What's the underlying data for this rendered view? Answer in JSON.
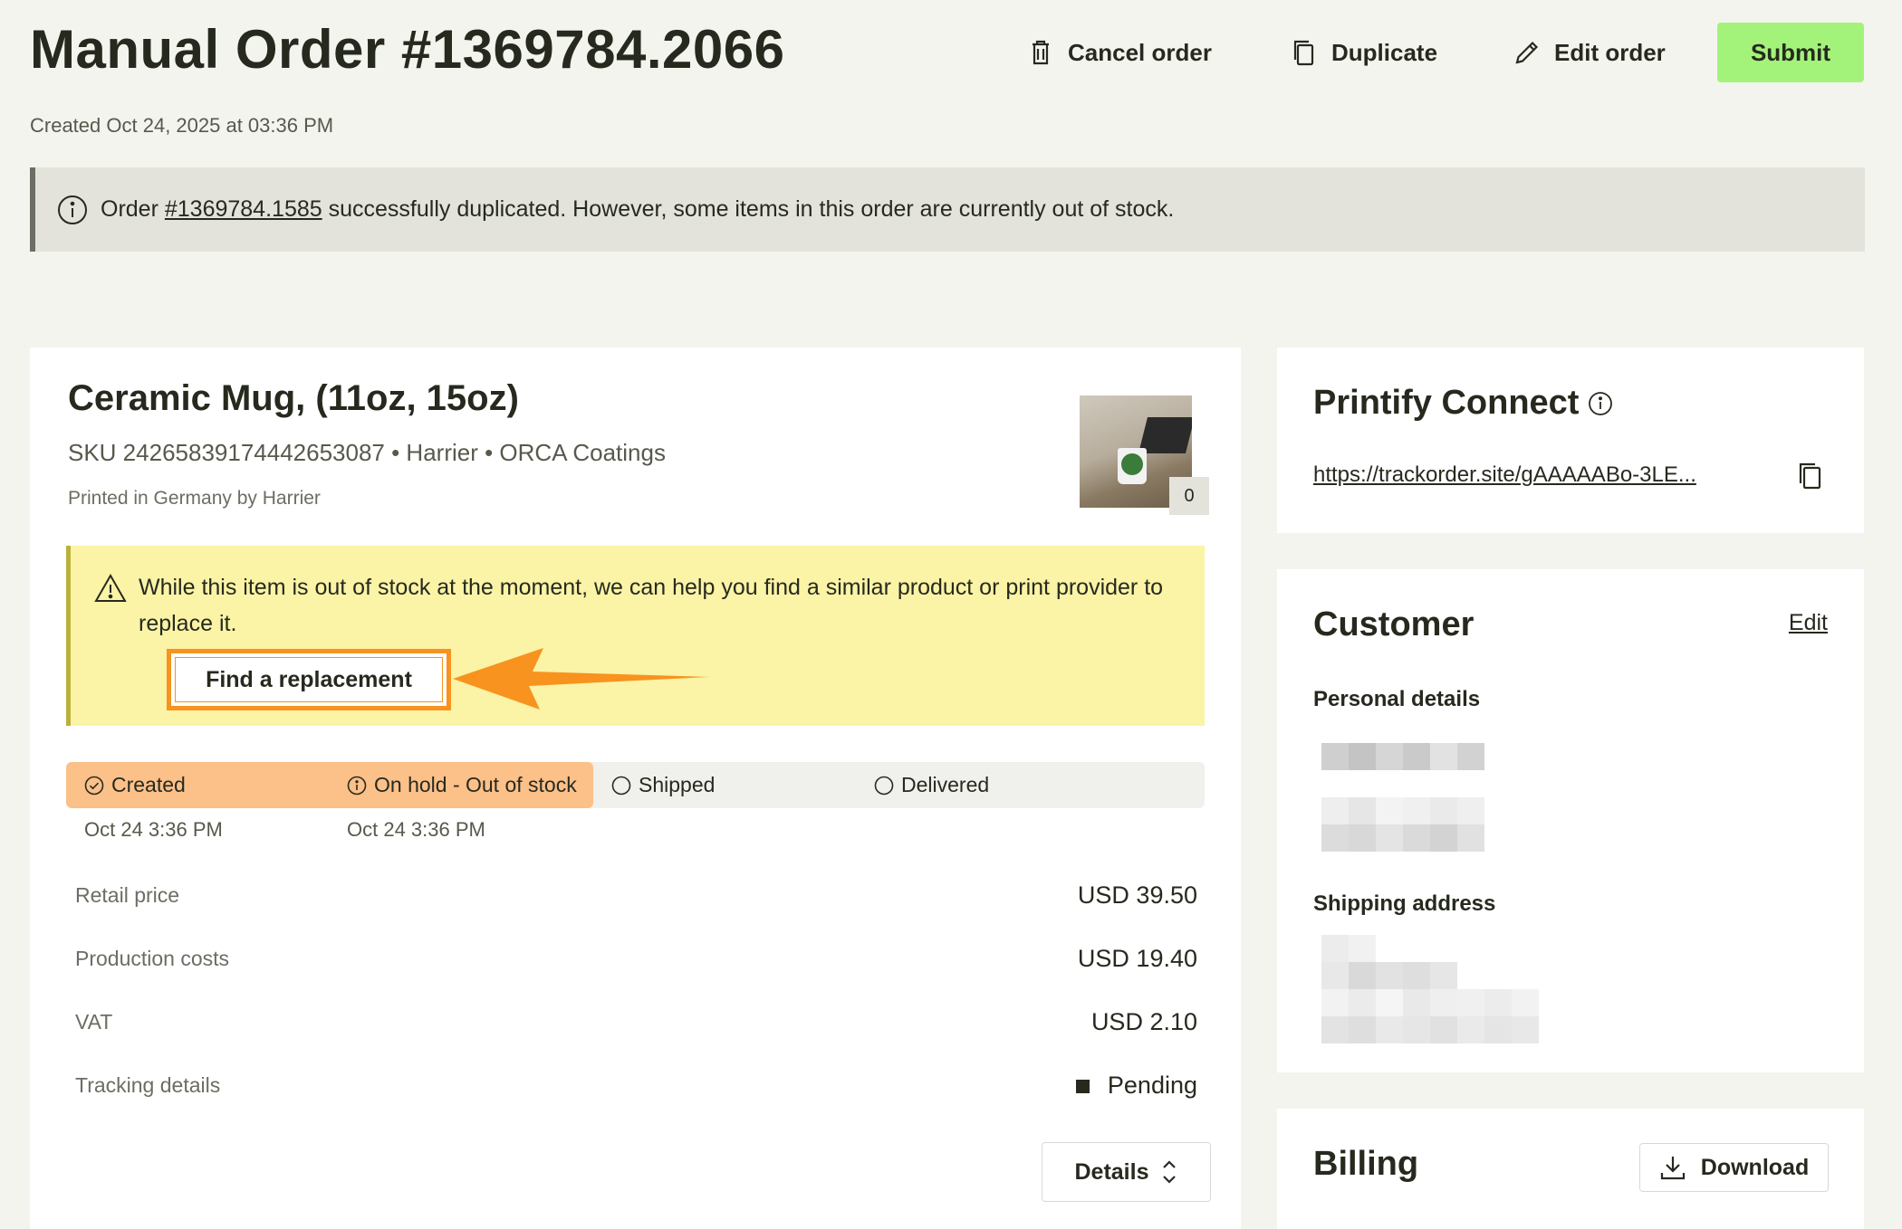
{
  "header": {
    "title": "Manual Order #1369784.2066",
    "created": "Created Oct 24, 2025 at 03:36 PM",
    "actions": {
      "cancel": "Cancel order",
      "duplicate": "Duplicate",
      "edit": "Edit order",
      "submit": "Submit"
    }
  },
  "banner": {
    "prefix": "Order",
    "link": "#1369784.1585",
    "suffix": " successfully duplicated. However, some items in this order are currently out of stock."
  },
  "product": {
    "title": "Ceramic Mug, (11oz, 15oz)",
    "sku_line": "SKU 24265839174442653087 • Harrier • ORCA Coatings",
    "printed": "Printed in Germany by Harrier",
    "thumb_count": "0",
    "warning": "While this item is out of stock at the moment, we can help you find a similar product or print provider to replace it.",
    "replace_button": "Find a replacement",
    "status": {
      "steps": [
        {
          "label": "Created",
          "date": "Oct 24 3:36 PM"
        },
        {
          "label": "On hold - Out of stock",
          "date": "Oct 24 3:36 PM"
        },
        {
          "label": "Shipped",
          "date": ""
        },
        {
          "label": "Delivered",
          "date": ""
        }
      ],
      "progress_steps_completed": 2
    },
    "rows": [
      {
        "label": "Retail price",
        "value": "USD 39.50"
      },
      {
        "label": "Production costs",
        "value": "USD 19.40"
      },
      {
        "label": "VAT",
        "value": "USD 2.10"
      },
      {
        "label": "Tracking details",
        "value": "Pending"
      }
    ],
    "details_button": "Details"
  },
  "connect": {
    "title": "Printify Connect",
    "url": "https://trackorder.site/gAAAAABo-3LE..."
  },
  "customer": {
    "title": "Customer",
    "edit": "Edit",
    "personal_label": "Personal details",
    "shipping_label": "Shipping address"
  },
  "billing": {
    "title": "Billing",
    "download": "Download"
  },
  "colors": {
    "submit": "#a3f37a",
    "status_fill": "#fcc089",
    "warning_bg": "#fbf3a6",
    "highlight": "#f7931e"
  }
}
